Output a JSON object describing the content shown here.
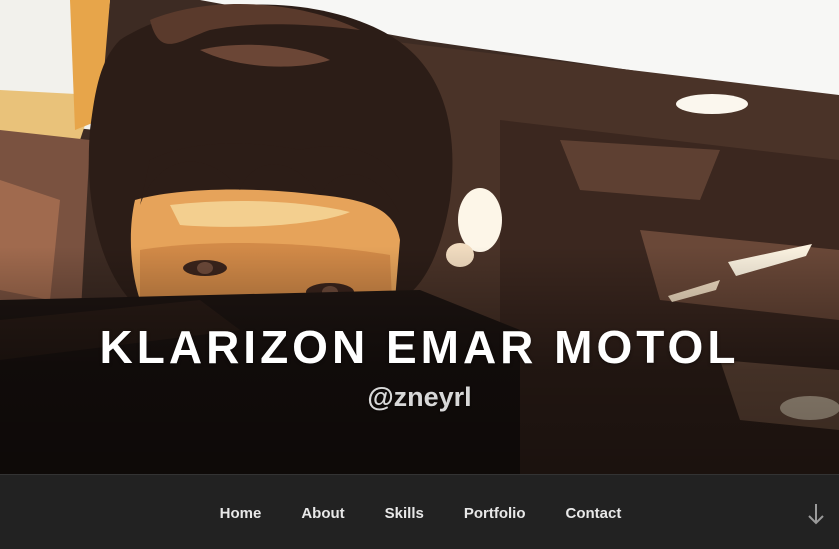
{
  "site": {
    "title": "KLARIZON EMAR MOTOL",
    "description": "@zneyrl"
  },
  "nav": {
    "items": [
      {
        "label": "Home"
      },
      {
        "label": "About"
      },
      {
        "label": "Skills"
      },
      {
        "label": "Portfolio"
      },
      {
        "label": "Contact"
      }
    ],
    "scroll_icon": "arrow-down-icon"
  },
  "hero": {
    "image": "header-photo-posterized-portrait"
  },
  "colors": {
    "nav_background": "#222222",
    "nav_text": "#e8e8e8",
    "title_text": "#ffffff",
    "description_text": "#d8d8d8"
  }
}
